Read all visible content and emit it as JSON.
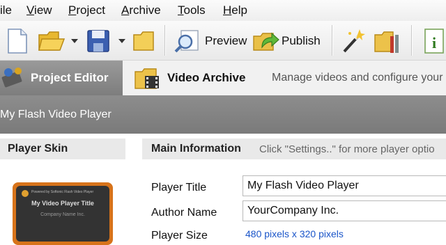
{
  "menu": [
    {
      "label": "ile"
    },
    {
      "label": "View",
      "accel": "V",
      "rest": "iew"
    },
    {
      "label": "Project",
      "accel": "P",
      "rest": "roject"
    },
    {
      "label": "Archive",
      "accel": "A",
      "rest": "rchive"
    },
    {
      "label": "Tools",
      "accel": "T",
      "rest": "ools"
    },
    {
      "label": "Help",
      "accel": "H",
      "rest": "elp"
    }
  ],
  "toolbar": {
    "preview_label": "Preview",
    "publish_label": "Publish"
  },
  "tabs": {
    "project_editor": "Project Editor",
    "video_archive": "Video Archive",
    "description": "Manage videos and configure your"
  },
  "project": {
    "title": "My Flash Video Player"
  },
  "skin": {
    "heading": "Player Skin",
    "preview_line1": "Powered by Softonic Flash Video Player",
    "preview_title": "My Video Player Title",
    "preview_company": "Company Name Inc."
  },
  "main": {
    "heading": "Main Information",
    "hint": "Click \"Settings..\" for more player optio",
    "player_title_label": "Player Title",
    "player_title_value": "My Flash Video Player",
    "author_name_label": "Author Name",
    "author_name_value": "YourCompany Inc.",
    "player_size_label": "Player Size",
    "player_size_value": "480 pixels x 320 pixels"
  },
  "colors": {
    "tab_active": "#8a8a8a",
    "project_bar": "#828282",
    "skin_border": "#d7731a",
    "link": "#1a55c9"
  }
}
